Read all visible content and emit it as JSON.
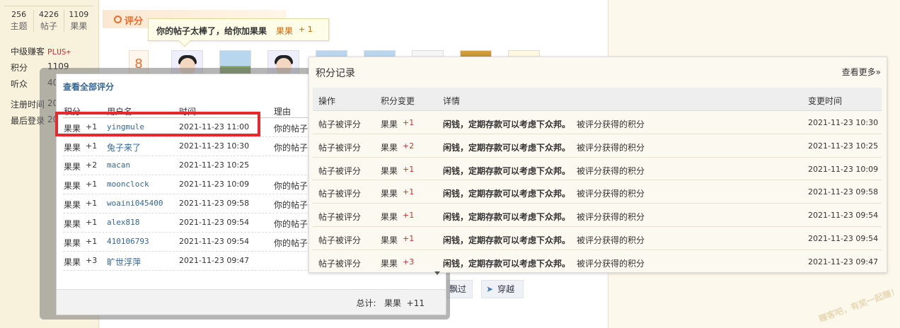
{
  "profile": {
    "stats": [
      {
        "num": "256",
        "label": "主题"
      },
      {
        "num": "4226",
        "label": "帖子"
      },
      {
        "num": "1109",
        "label": "果果"
      }
    ],
    "rank": "中级赚客",
    "rank_badge": "PLUS+",
    "points_label": "积分",
    "points_value": "1109",
    "listeners_label": "听众",
    "listeners_value": "40",
    "register_label": "注册时间",
    "register_value": "20",
    "lastlogin_label": "最后登录",
    "lastlogin_value": "20"
  },
  "rate_section": {
    "label": "评分",
    "count": "8",
    "tooltip_text": "你的帖子太棒了，给你加果果",
    "tooltip_item": "果果",
    "tooltip_amount": "+ 1"
  },
  "buttons": {
    "float_label": "飘过",
    "traverse_label": "穿越"
  },
  "watermark": "赚客吧，有奖一起赚！ www.zuanke8.com",
  "rate_dialog": {
    "title": "查看全部评分",
    "headers": {
      "score": "积分",
      "user": "用户名",
      "time": "时间",
      "reason": "理由"
    },
    "rows": [
      {
        "item": "果果",
        "amt": "+1",
        "user": "yingmule",
        "time": "2021-11-23 11:00",
        "reason": "你的帖子"
      },
      {
        "item": "果果",
        "amt": "+1",
        "user": "兔子来了",
        "time": "2021-11-23 10:30",
        "reason": "你的帖子"
      },
      {
        "item": "果果",
        "amt": "+2",
        "user": "macan",
        "time": "2021-11-23 10:25",
        "reason": ""
      },
      {
        "item": "果果",
        "amt": "+1",
        "user": "moonclock",
        "time": "2021-11-23 10:09",
        "reason": "你的帖子"
      },
      {
        "item": "果果",
        "amt": "+1",
        "user": "woaini045400",
        "time": "2021-11-23 09:58",
        "reason": "你的帖子"
      },
      {
        "item": "果果",
        "amt": "+1",
        "user": "alex818",
        "time": "2021-11-23 09:54",
        "reason": "你的帖子"
      },
      {
        "item": "果果",
        "amt": "+1",
        "user": "410106793",
        "time": "2021-11-23 09:54",
        "reason": "你的帖子"
      },
      {
        "item": "果果",
        "amt": "+3",
        "user": "旷世浮萍",
        "time": "2021-11-23 09:47",
        "reason": ""
      }
    ],
    "total_label": "总计:",
    "total_item": "果果",
    "total_amount": "+11"
  },
  "points_panel": {
    "title": "积分记录",
    "more": "查看更多»",
    "headers": {
      "action": "操作",
      "change": "积分变更",
      "detail": "详情",
      "time": "变更时间"
    },
    "rows": [
      {
        "action": "帖子被评分",
        "item": "果果",
        "amt": "+1",
        "title": "闲钱，定期存款可以考虑下众邦。",
        "note": "被评分获得的积分",
        "time": "2021-11-23 10:30"
      },
      {
        "action": "帖子被评分",
        "item": "果果",
        "amt": "+2",
        "title": "闲钱，定期存款可以考虑下众邦。",
        "note": "被评分获得的积分",
        "time": "2021-11-23 10:25"
      },
      {
        "action": "帖子被评分",
        "item": "果果",
        "amt": "+1",
        "title": "闲钱，定期存款可以考虑下众邦。",
        "note": "被评分获得的积分",
        "time": "2021-11-23 10:09"
      },
      {
        "action": "帖子被评分",
        "item": "果果",
        "amt": "+1",
        "title": "闲钱，定期存款可以考虑下众邦。",
        "note": "被评分获得的积分",
        "time": "2021-11-23 09:58"
      },
      {
        "action": "帖子被评分",
        "item": "果果",
        "amt": "+1",
        "title": "闲钱，定期存款可以考虑下众邦。",
        "note": "被评分获得的积分",
        "time": "2021-11-23 09:54"
      },
      {
        "action": "帖子被评分",
        "item": "果果",
        "amt": "+1",
        "title": "闲钱，定期存款可以考虑下众邦。",
        "note": "被评分获得的积分",
        "time": "2021-11-23 09:54"
      },
      {
        "action": "帖子被评分",
        "item": "果果",
        "amt": "+3",
        "title": "闲钱，定期存款可以考虑下众邦。",
        "note": "被评分获得的积分",
        "time": "2021-11-23 09:47"
      }
    ]
  },
  "colors": {
    "accent": "#f06b2a",
    "link": "#336699",
    "highlight": "#e8282c"
  }
}
